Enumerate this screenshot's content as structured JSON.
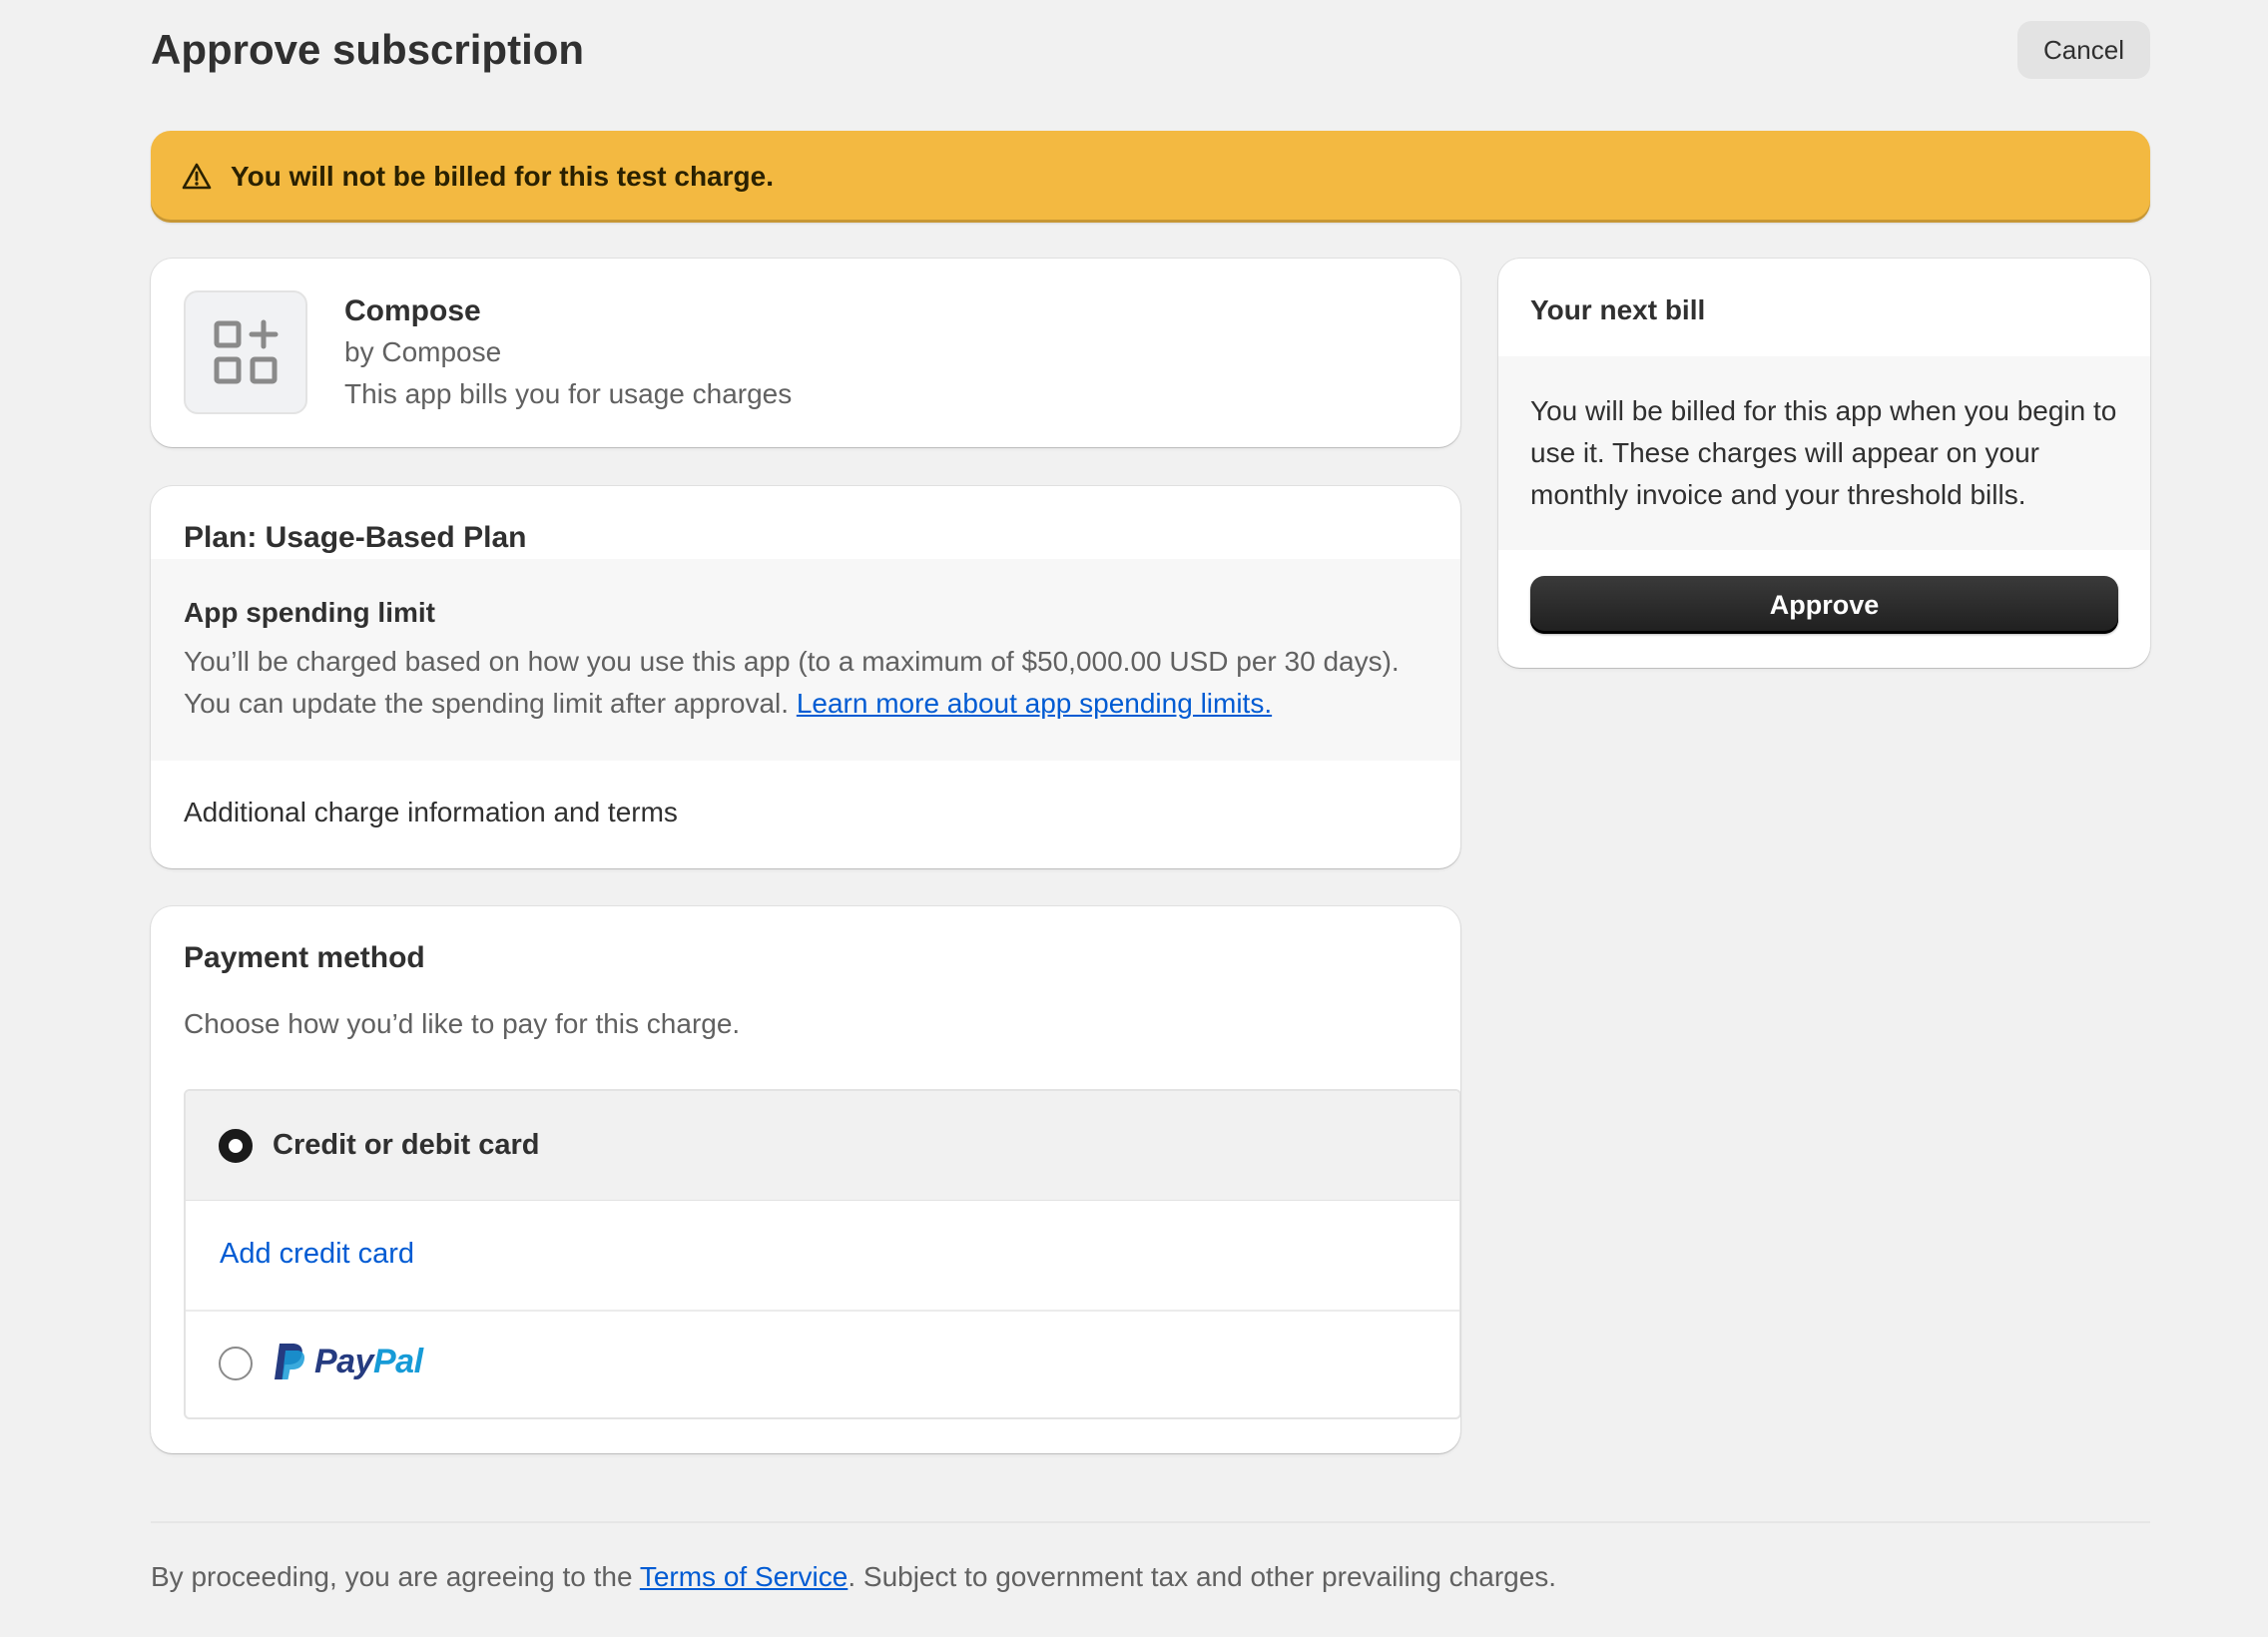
{
  "header": {
    "title": "Approve subscription",
    "cancel_label": "Cancel"
  },
  "banner": {
    "icon": "warning-triangle-icon",
    "text": "You will not be billed for this test charge.",
    "color": "#f3b941"
  },
  "app": {
    "icon": "apps-grid-icon",
    "name": "Compose",
    "by": "by Compose",
    "description": "This app bills you for usage charges"
  },
  "plan": {
    "title": "Plan: Usage-Based Plan",
    "limit_title": "App spending limit",
    "limit_description": "You’ll be charged based on how you use this app (to a maximum of $50,000.00 USD per 30 days). You can update the spending limit after approval.",
    "limit_link": "Learn more about app spending limits.",
    "additional_terms": "Additional charge information and terms"
  },
  "payment": {
    "title": "Payment method",
    "subtitle": "Choose how you’d like to pay for this charge.",
    "selected": "card",
    "card_option_label": "Credit or debit card",
    "add_card_link": "Add credit card",
    "paypal_pay": "Pay",
    "paypal_pal": "Pal"
  },
  "next_bill": {
    "title": "Your next bill",
    "description": "You will be billed for this app when you begin to use it. These charges will appear on your monthly invoice and your threshold bills.",
    "approve_label": "Approve"
  },
  "footer": {
    "prefix": "By proceeding, you are agreeing to the ",
    "terms_link": "Terms of Service",
    "suffix": ". Subject to government tax and other prevailing charges."
  },
  "colors": {
    "background": "#f1f1f1",
    "banner": "#f3b941",
    "link": "#005bd3",
    "primary_button": "#1f1f1f"
  }
}
